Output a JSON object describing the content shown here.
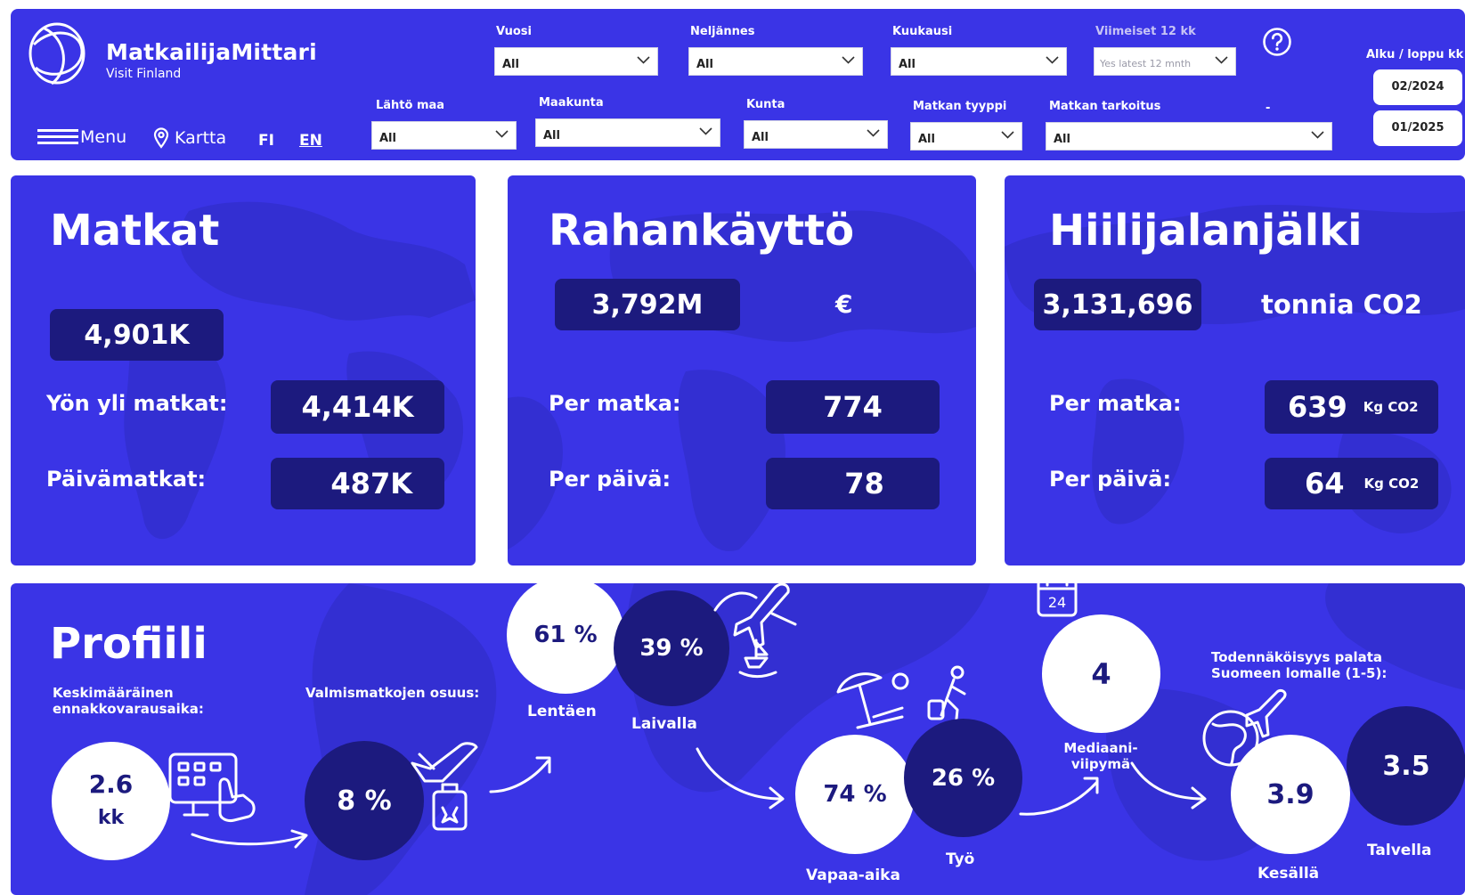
{
  "header": {
    "brand": "MatkailijaMittari",
    "brand_sub": "Visit Finland",
    "menu_label": "Menu",
    "map_label": "Kartta",
    "lang_fi": "FI",
    "lang_en": "EN",
    "filters_row1": [
      {
        "label": "Vuosi",
        "value": "All"
      },
      {
        "label": "Neljännes",
        "value": "All"
      },
      {
        "label": "Kuukausi",
        "value": "All"
      },
      {
        "label": "Viimeiset 12 kk",
        "value": "Yes latest 12 mnth"
      }
    ],
    "filters_row2": [
      {
        "label": "Lähtö maa",
        "value": "All"
      },
      {
        "label": "Maakunta",
        "value": "All"
      },
      {
        "label": "Kunta",
        "value": "All"
      },
      {
        "label": "Matkan tyyppi",
        "value": "All"
      },
      {
        "label": "Matkan tarkoitus",
        "value": "All"
      }
    ],
    "dash": "-",
    "help_icon": "question-circle-icon",
    "range_label": "Alku / loppu kk",
    "start_month": "02/2024",
    "end_month": "01/2025"
  },
  "matkat": {
    "title": "Matkat",
    "total": "4,901K",
    "overnight_label": "Yön yli matkat:",
    "overnight_value": "4,414K",
    "day_label": "Päivämatkat:",
    "day_value": "487K"
  },
  "rahankaytto": {
    "title": "Rahankäyttö",
    "total": "3,792M",
    "currency": "€",
    "per_trip_label": "Per matka:",
    "per_trip_value": "774",
    "per_day_label": "Per päivä:",
    "per_day_value": "78"
  },
  "hiili": {
    "title": "Hiilijalanjälki",
    "total": "3,131,696",
    "unit": "tonnia CO2",
    "per_trip_label": "Per matka:",
    "per_trip_value": "639",
    "per_trip_unit": "Kg CO2",
    "per_day_label": "Per päivä:",
    "per_day_value": "64",
    "per_day_unit": "Kg CO2"
  },
  "profiili": {
    "title": "Profiili",
    "booking_label": "Keskimääräinen ennakkovarausaika:",
    "booking_value": "2.6",
    "booking_unit": "kk",
    "package_label": "Valmismatkojen osuus:",
    "package_value": "8 %",
    "flight_value": "61 %",
    "flight_label": "Lentäen",
    "ship_value": "39 %",
    "ship_label": "Laivalla",
    "leisure_value": "74 %",
    "leisure_label": "Vapaa-aika",
    "work_value": "26 %",
    "work_label": "Työ",
    "median_value": "4",
    "median_label": "Mediaani-viipymä",
    "calendar_number": "24",
    "return_label": "Todennäköisyys palata Suomeen lomalle (1-5):",
    "summer_value": "3.9",
    "summer_label": "Kesällä",
    "winter_value": "3.5",
    "winter_label": "Talvella"
  }
}
